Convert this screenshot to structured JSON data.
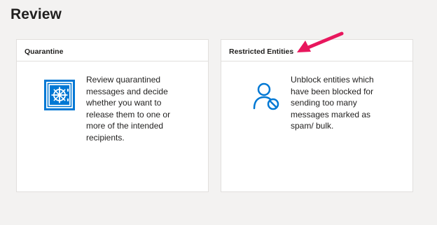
{
  "page": {
    "title": "Review"
  },
  "cards": [
    {
      "title": "Quarantine",
      "description": "Review quarantined messages and decide whether you want to release them to one or more of the intended recipients.",
      "icon": "vault-icon"
    },
    {
      "title": "Restricted Entities",
      "description": "Unblock entities which have been blocked for sending too many messages marked as spam/ bulk.",
      "icon": "blocked-user-icon"
    }
  ],
  "annotation": {
    "icon": "pointer-arrow-icon"
  },
  "colors": {
    "accent": "#0078d4",
    "arrow": "#e8175d",
    "background": "#f3f2f1",
    "card": "#ffffff",
    "border": "#e1dfdd"
  }
}
